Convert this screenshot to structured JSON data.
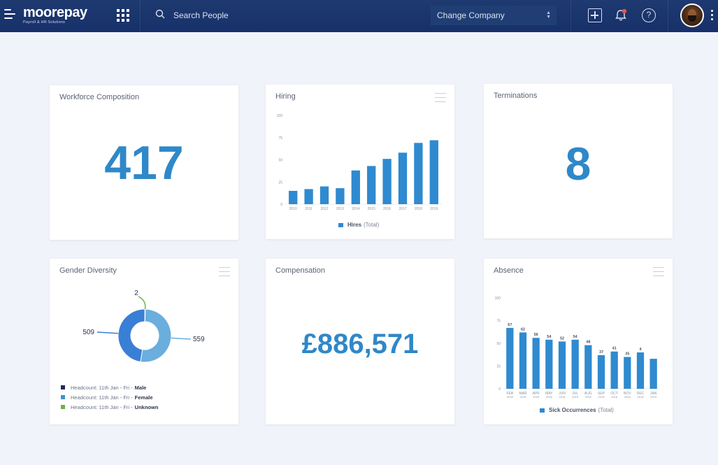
{
  "topbar": {
    "logo_main": "moorepay",
    "logo_sub": "Payroll & HR Solutions",
    "search_placeholder": "Search People",
    "company_select": "Change Company",
    "notification_badge": true,
    "help_label": "?",
    "icons": [
      "hamburger-menu-icon",
      "apps-grid-icon",
      "search-icon",
      "add-box-icon",
      "bell-icon",
      "help-icon",
      "avatar",
      "kebab-menu-icon"
    ]
  },
  "cards": {
    "workforce": {
      "title": "Workforce Composition",
      "value": "417"
    },
    "hiring": {
      "title": "Hiring",
      "legend_name": "Hires",
      "legend_suffix": "(Total)"
    },
    "terminations": {
      "title": "Terminations",
      "value": "8"
    },
    "gender": {
      "title": "Gender Diversity",
      "legend": [
        {
          "prefix": "Headcount: 11th Jan - Fri -",
          "label": "Male",
          "color": "#1b2c5a"
        },
        {
          "prefix": "Headcount: 11th Jan - Fri -",
          "label": "Female",
          "color": "#3f94d3"
        },
        {
          "prefix": "Headcount: 11th Jan - Fri -",
          "label": "Unknown",
          "color": "#6cb33f"
        }
      ]
    },
    "compensation": {
      "title": "Compensation",
      "value": "£886,571"
    },
    "absence": {
      "title": "Absence",
      "legend_name": "Sick Occurrences",
      "legend_suffix": "(Total)"
    }
  },
  "colors": {
    "accent": "#2f88c8",
    "topbar": "#1b356c",
    "bar": "#2f8ad0",
    "female": "#6aaede",
    "male": "#3a7fd6",
    "unknown": "#6cb33f"
  },
  "chart_data": [
    {
      "id": "hiring",
      "type": "bar",
      "title": "Hiring",
      "categories": [
        "2010",
        "2011",
        "2012",
        "2013",
        "2014",
        "2015",
        "2016",
        "2017",
        "2018",
        "2019"
      ],
      "series": [
        {
          "name": "Hires (Total)",
          "values": [
            15,
            17,
            20,
            18,
            38,
            43,
            51,
            58,
            69,
            72
          ]
        }
      ],
      "yticks": [
        0,
        25,
        50,
        75,
        100
      ],
      "ylim": [
        0,
        100
      ],
      "legend": "bottom"
    },
    {
      "id": "gender",
      "type": "pie",
      "title": "Gender Diversity",
      "series": [
        {
          "name": "Female",
          "value": 559
        },
        {
          "name": "Male",
          "value": 509
        },
        {
          "name": "Unknown",
          "value": 2
        }
      ],
      "donut": true,
      "legend": "bottom-left"
    },
    {
      "id": "absence",
      "type": "bar",
      "title": "Absence",
      "categories": [
        "FEB",
        "MAR",
        "APR",
        "MAY",
        "JUN",
        "JUL",
        "AUG",
        "SEP",
        "OCT",
        "NOV",
        "DEC",
        "JAN"
      ],
      "category_years": [
        "2018",
        "2018",
        "2018",
        "2018",
        "2018",
        "2018",
        "2018",
        "2018",
        "2018",
        "2018",
        "2018",
        "2019"
      ],
      "series": [
        {
          "name": "Sick Occurrences (Total)",
          "values": [
            67,
            62,
            56,
            54,
            52,
            54,
            48,
            37,
            41,
            35,
            40,
            33
          ]
        }
      ],
      "data_labels": [
        "67",
        "62",
        "56",
        "54",
        "52",
        "54",
        "48",
        "37",
        "41",
        "35",
        "4",
        ""
      ],
      "yticks": [
        0,
        25,
        50,
        75,
        100
      ],
      "ylim": [
        0,
        100
      ],
      "legend": "bottom"
    }
  ]
}
